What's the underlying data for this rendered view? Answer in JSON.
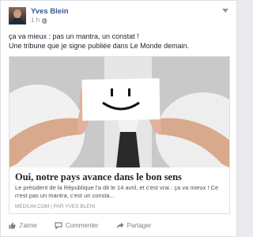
{
  "post": {
    "author": "Yves Blein",
    "timestamp": "1 h",
    "privacy_icon": "globe-icon",
    "text_line1": "ça va mieux : pas un mantra, un constat !",
    "text_line2": "Une tribune que je signe publiée dans Le Monde demain."
  },
  "link": {
    "image_description_icon": "smiley-card-image",
    "title": "Oui, notre pays avance dans le bon sens",
    "description": "Le président de la République l'a dit le 14 avril, et c'est vrai : ça va mieux ! Ce n'est pas un mantra, c'est un consta...",
    "source": "MEDIUM.COM | PAR YVES BLEIN"
  },
  "actions": {
    "like": "J'aime",
    "comment": "Commenter",
    "share": "Partager"
  },
  "colors": {
    "author_link": "#365899",
    "meta_gray": "#90949c",
    "action_gray": "#7f7f7f"
  }
}
